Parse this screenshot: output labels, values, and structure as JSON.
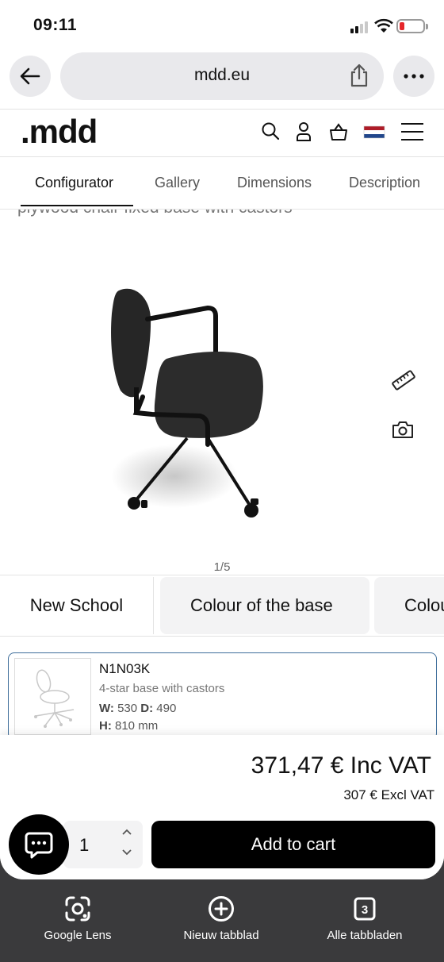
{
  "status_bar": {
    "time": "09:11"
  },
  "browser": {
    "url": "mdd.eu",
    "bottom_bar": [
      {
        "label": "Google Lens",
        "icon": "google-lens-icon"
      },
      {
        "label": "Nieuw tabblad",
        "icon": "plus-circle-icon"
      },
      {
        "label": "Alle tabbladen",
        "icon": "tabs-count-icon",
        "count": "3"
      }
    ]
  },
  "site": {
    "logo": ".mdd",
    "header_icons": [
      "search-icon",
      "user-icon",
      "basket-icon",
      "flag-nl-icon",
      "menu-icon"
    ],
    "flag_colors": [
      "#ae1c28",
      "#ffffff",
      "#21468b"
    ]
  },
  "tabs": [
    {
      "label": "Configurator",
      "active": true
    },
    {
      "label": "Gallery",
      "active": false
    },
    {
      "label": "Dimensions",
      "active": false
    },
    {
      "label": "Description",
      "active": false
    }
  ],
  "product": {
    "subtitle": "plywood chair fixed base with castors",
    "image_counter": "1/5",
    "viewer_icons": [
      "ruler-icon",
      "camera-icon"
    ]
  },
  "options": [
    {
      "label": "New School"
    },
    {
      "label": "Colour of the base"
    },
    {
      "label": "Colour"
    }
  ],
  "selected_variant": {
    "code": "N1N03K",
    "description": "4-star base with castors",
    "w_label": "W:",
    "w_value": "530",
    "d_label": "D:",
    "d_value": "490",
    "h_label": "H:",
    "h_value": "810 mm"
  },
  "pricing": {
    "price_inc": "371,47 € Inc VAT",
    "price_excl": "307 € Excl VAT",
    "quantity": "1",
    "add_to_cart": "Add to cart"
  },
  "colors": {
    "accent": "#000000",
    "card_border": "#3d6d9a",
    "battery_low": "#e5262a"
  }
}
